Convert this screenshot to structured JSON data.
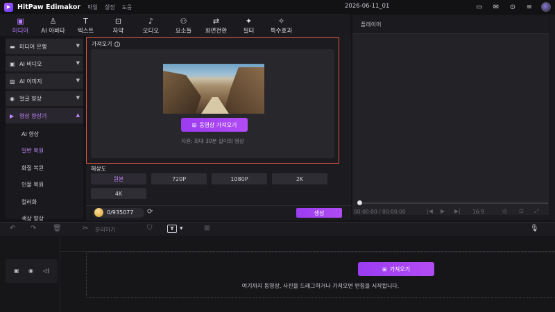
{
  "titlebar": {
    "app_name": "HitPaw Edimakor",
    "menus": [
      "파일",
      "설정",
      "도움"
    ],
    "project_name": "2026-06-11_01",
    "icons": [
      "layout-icon",
      "feedback-icon",
      "download-icon",
      "menu-icon",
      "avatar"
    ]
  },
  "toolbar": {
    "tools": [
      {
        "label": "미디어",
        "icon": "folder-icon",
        "active": true
      },
      {
        "label": "AI 아바타",
        "icon": "avatar-add-icon",
        "active": false
      },
      {
        "label": "텍스트",
        "icon": "text-icon",
        "active": false
      },
      {
        "label": "자막",
        "icon": "subtitle-icon",
        "active": false
      },
      {
        "label": "오디오",
        "icon": "music-icon",
        "active": false
      },
      {
        "label": "요소들",
        "icon": "elements-icon",
        "active": false
      },
      {
        "label": "화면전환",
        "icon": "transition-icon",
        "active": false
      },
      {
        "label": "필터",
        "icon": "filter-icon",
        "active": false
      },
      {
        "label": "특수효과",
        "icon": "effects-icon",
        "active": false
      }
    ]
  },
  "sidebar": {
    "items": [
      {
        "label": "미디어 은행",
        "icon": "folder-icon"
      },
      {
        "label": "AI 비디오",
        "icon": "video-icon"
      },
      {
        "label": "AI 이미지",
        "icon": "image-icon"
      },
      {
        "label": "얼굴 향상",
        "icon": "face-icon"
      },
      {
        "label": "영상 향상기",
        "icon": "enhance-icon",
        "open": true
      }
    ],
    "sub_items": [
      {
        "label": "AI 향상",
        "active": false
      },
      {
        "label": "일반 복원",
        "active": true
      },
      {
        "label": "화질 복원",
        "active": false
      },
      {
        "label": "인물 복원",
        "active": false
      },
      {
        "label": "컬러화",
        "active": false
      },
      {
        "label": "색상 향상",
        "active": false
      }
    ]
  },
  "main": {
    "import_label": "가져오기",
    "import_button": "동영상 가져오기",
    "limit_text": "지원: 최대 30분 길이의 영상",
    "resolution_label": "해상도",
    "resolutions": [
      {
        "label": "원본",
        "active": true
      },
      {
        "label": "720P",
        "active": false
      },
      {
        "label": "1080P",
        "active": false
      },
      {
        "label": "2K",
        "active": false
      },
      {
        "label": "4K",
        "active": false
      }
    ],
    "credits": "0/935077",
    "generate_button": "생성"
  },
  "player": {
    "title": "플레이어",
    "timecode": "00:00:00 / 00:00:00",
    "ratio": "16:9"
  },
  "timeline": {
    "split_label": "분리하기",
    "import_button": "가져오기",
    "hint": "여기까지 동영상, 사진을 드래그하거나 가져오면 편집을 시작합니다."
  },
  "colors": {
    "accent": "#b57cff",
    "button": "#a040f2",
    "highlight_border": "#e0533f"
  }
}
